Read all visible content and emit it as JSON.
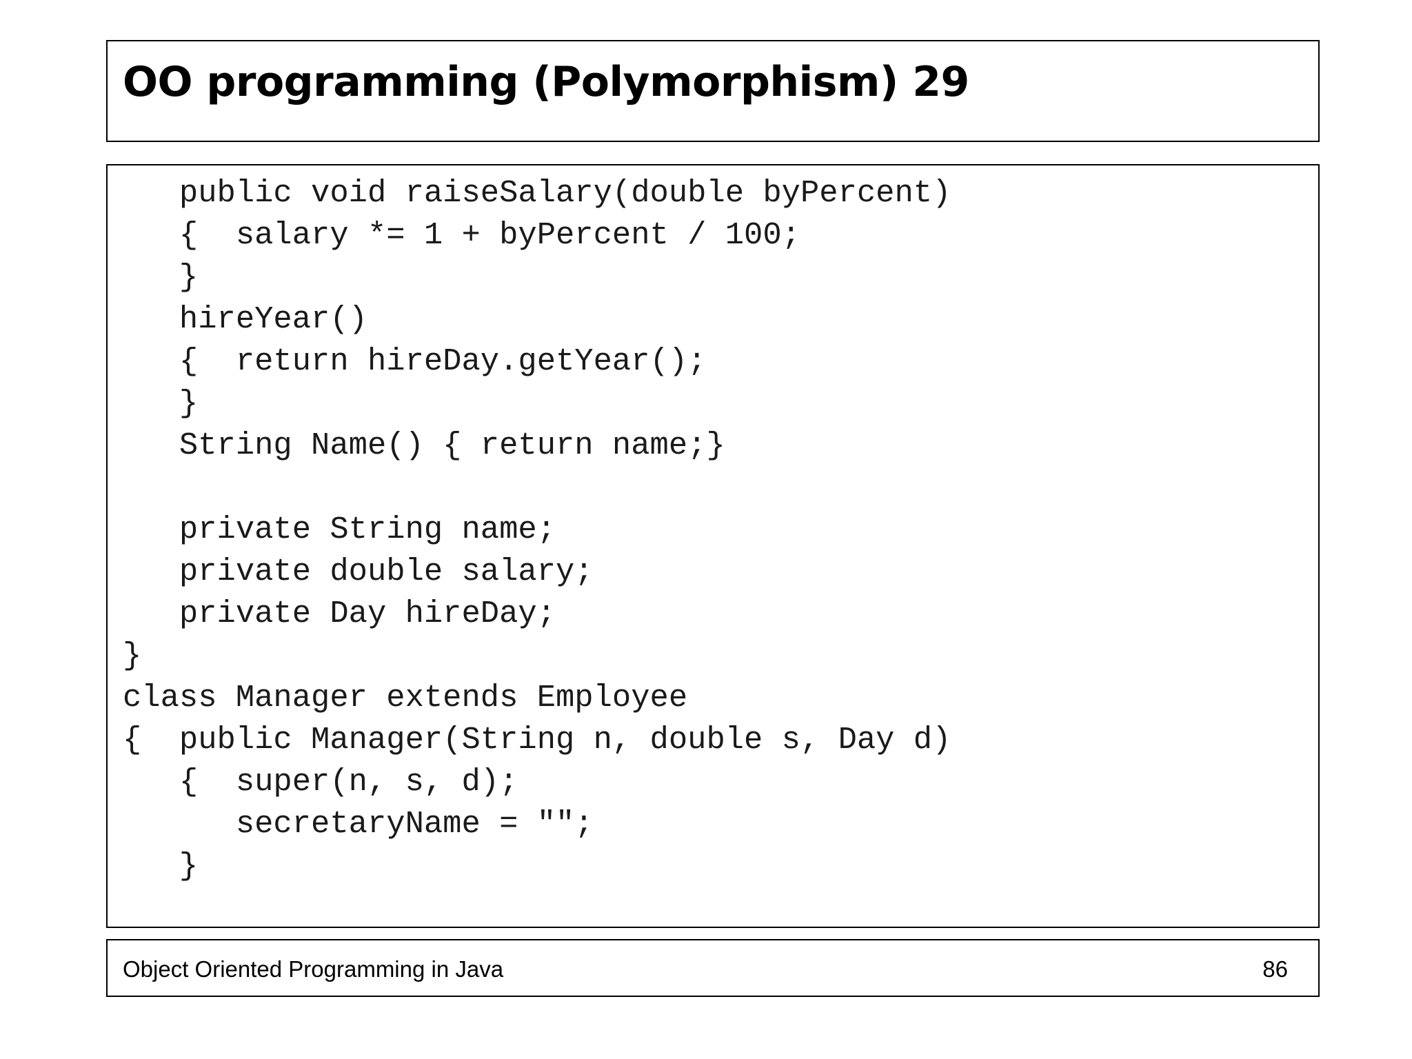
{
  "slide": {
    "title": "OO programming (Polymorphism) 29",
    "code_lines": [
      "   public void raiseSalary(double byPercent)",
      "   {  salary *= 1 + byPercent / 100;",
      "   }",
      "   hireYear()",
      "   {  return hireDay.getYear();",
      "   }",
      "   String Name() { return name;}",
      "",
      "   private String name;",
      "   private double salary;",
      "   private Day hireDay;",
      "}",
      "class Manager extends Employee",
      "{  public Manager(String n, double s, Day d)",
      "   {  super(n, s, d);",
      "      secretaryName = \"\";",
      "   }"
    ]
  },
  "footer": {
    "text": "Object Oriented Programming in Java",
    "page_number": "86"
  }
}
